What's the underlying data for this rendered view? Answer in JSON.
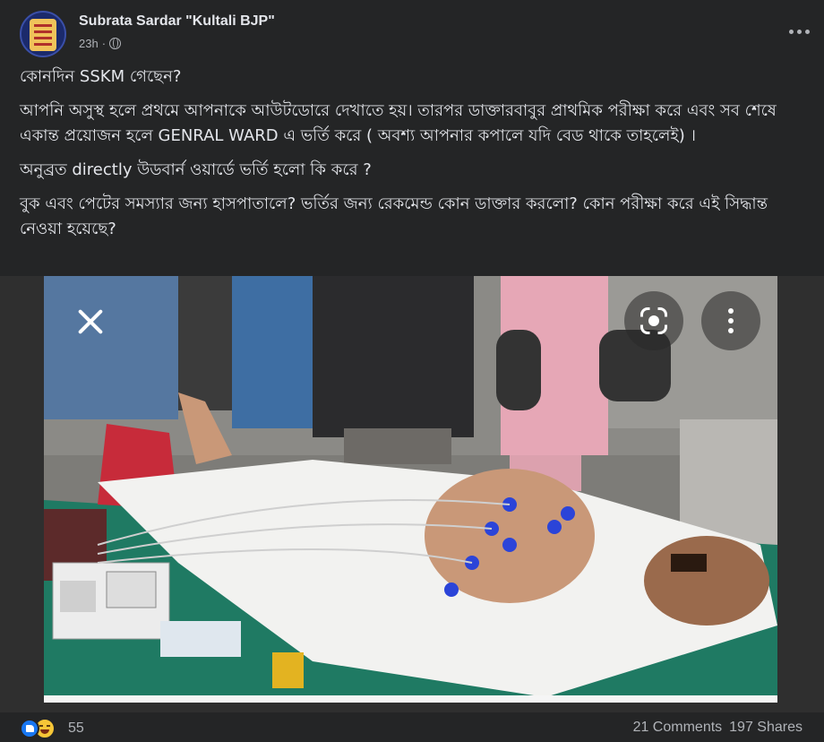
{
  "post": {
    "author": "Subrata Sardar \"Kultali BJP\"",
    "time": "23h",
    "paragraphs": [
      "কোনদিন SSKM গেছেন?",
      "আপনি অসুস্থ হলে প্রথমে আপনাকে আউটডোরে দেখাতে হয়। তারপর ডাক্তারবাবুর প্রাথমিক পরীক্ষা করে এবং সব শেষে একান্ত প্রয়োজন হলে GENRAL WARD এ ভর্তি করে ( অবশ্য আপনার কপালে যদি বেড থাকে তাহলেই) ।",
      "অনুব্রত directly উডবার্ন ওয়ার্ডে ভর্তি হলো কি করে ?",
      "বুক এবং পেটের সমস্যার জন্য হাসপাতালে? ভর্তির জন্য রেকমেন্ড কোন ডাক্তার করলো? কোন পরীক্ষা করে এই সিদ্ধান্ত নেওয়া হয়েছে?"
    ]
  },
  "image": {
    "description_icons": [
      "close-icon",
      "lens-icon",
      "more-vertical-icon"
    ]
  },
  "footer": {
    "reaction_count": "55",
    "comments": "21 Comments",
    "shares": "197 Shares"
  },
  "icons": [
    "avatar",
    "globe-icon",
    "more-horizontal-icon",
    "like-icon",
    "haha-icon"
  ],
  "colors": {
    "background": "#242526",
    "text": "#e4e6eb",
    "secondary_text": "#b0b3b8",
    "like_blue": "#1877f2"
  }
}
